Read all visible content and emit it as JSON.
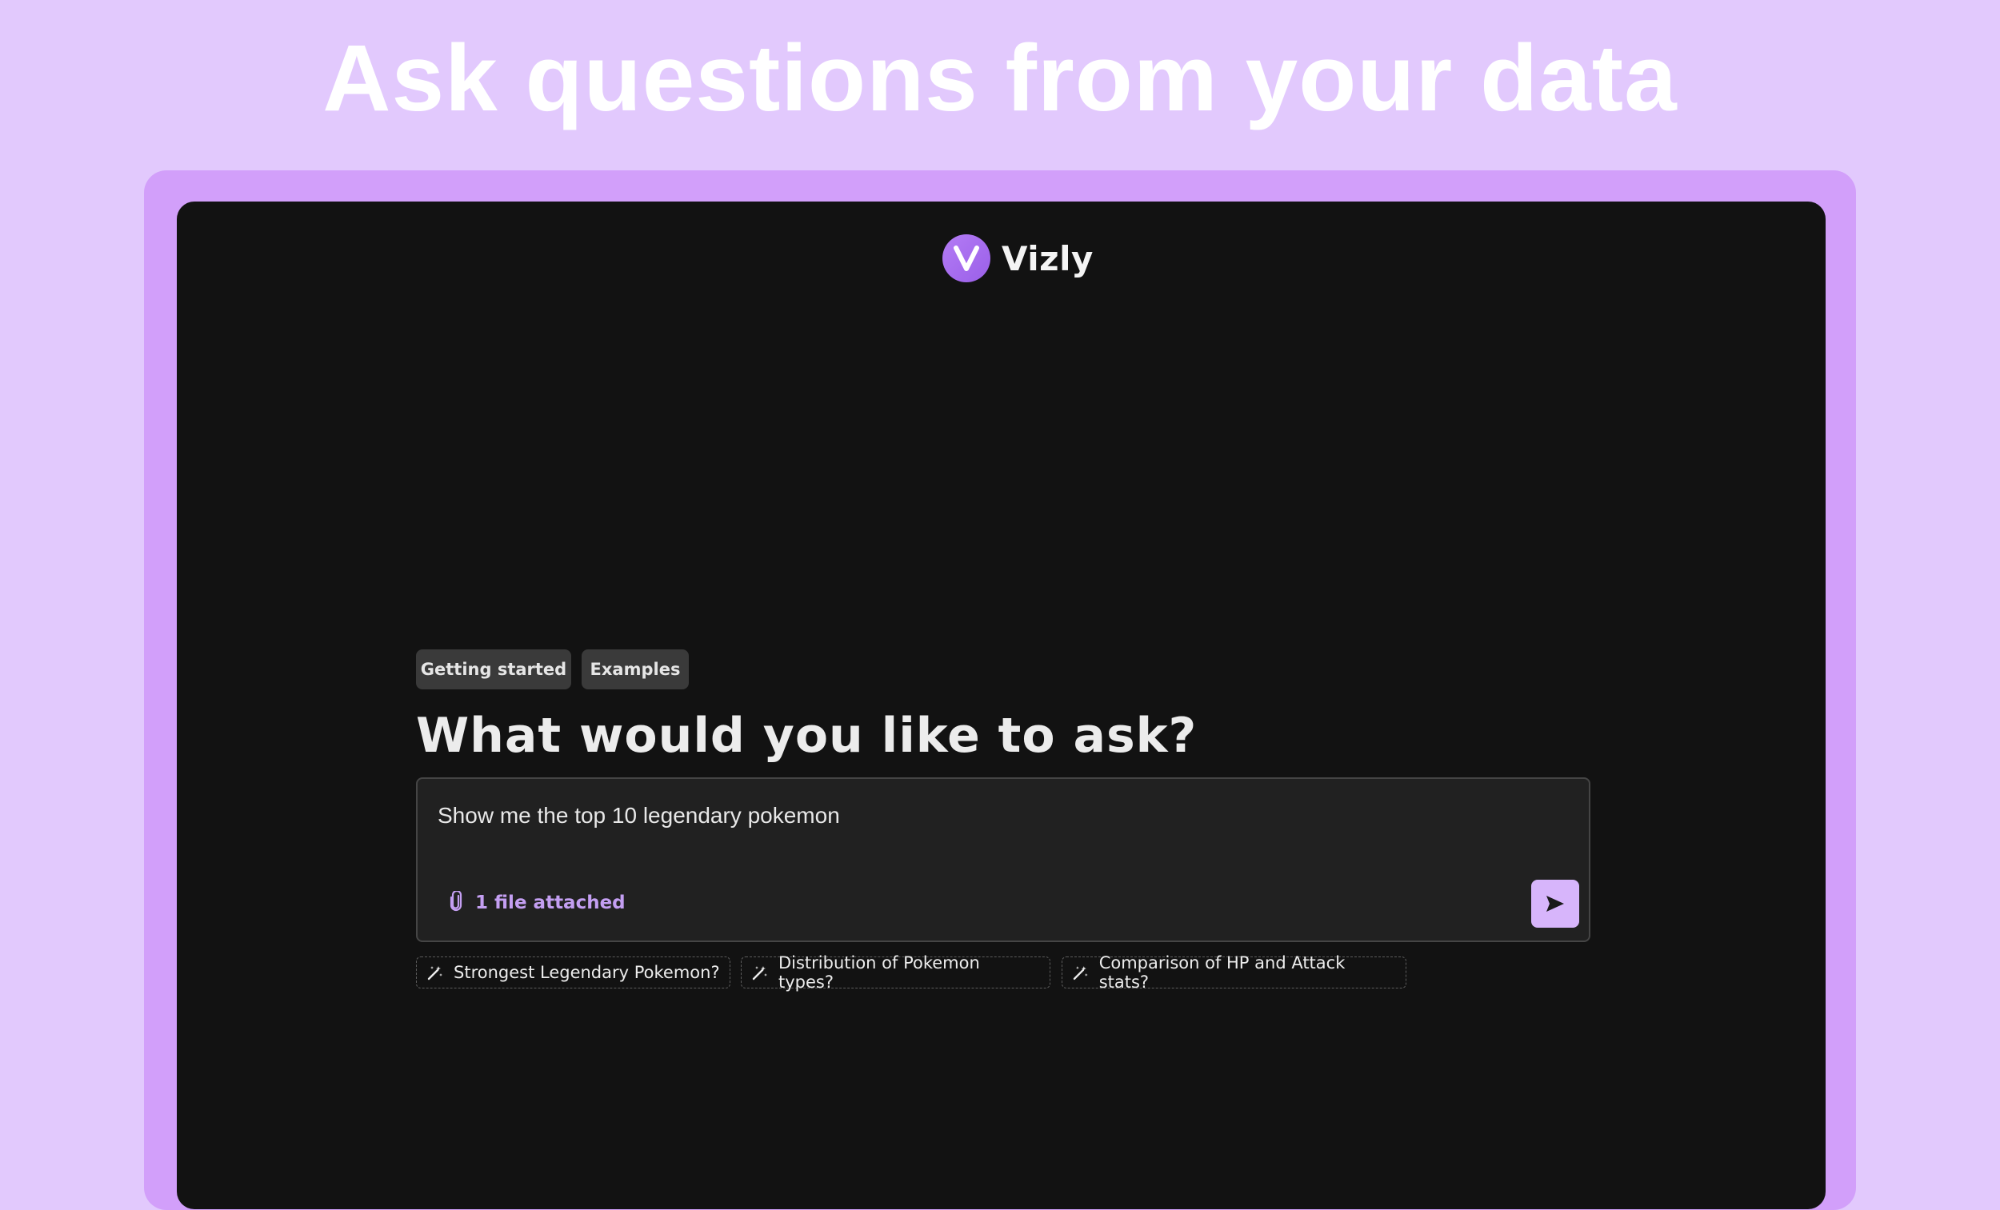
{
  "hero": {
    "title": "Ask questions from your data"
  },
  "brand": {
    "logo_letter": "V",
    "name": "Vizly"
  },
  "tabs": [
    {
      "label": "Getting started"
    },
    {
      "label": "Examples"
    }
  ],
  "main": {
    "heading": "What would you like to ask?"
  },
  "input": {
    "value": "Show me the top 10 legendary pokemon",
    "attachment_label": "1 file attached",
    "attachment_icon": "paperclip-icon",
    "send_icon": "send-icon"
  },
  "suggestions": [
    {
      "label": "Strongest Legendary Pokemon?",
      "icon": "magic-wand-icon"
    },
    {
      "label": "Distribution of Pokemon types?",
      "icon": "magic-wand-icon"
    },
    {
      "label": "Comparison of HP and Attack stats?",
      "icon": "magic-wand-icon"
    }
  ],
  "colors": {
    "page_background": "#e2c9fd",
    "frame": "#d29ffa",
    "window": "#121212",
    "accent": "#c49ff2",
    "send_button": "#d7b5fb"
  }
}
